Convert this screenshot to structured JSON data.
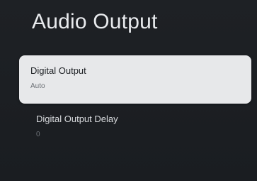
{
  "page": {
    "title": "Audio Output"
  },
  "menu": {
    "items": [
      {
        "label": "Digital Output",
        "value": "Auto",
        "focused": true
      },
      {
        "label": "Digital Output Delay",
        "value": "0",
        "focused": false
      }
    ]
  },
  "colors": {
    "background": "#1b1e22",
    "focused_card": "#e7e8ea",
    "title_text": "#e9ebee",
    "secondary_text": "#6e7278"
  }
}
